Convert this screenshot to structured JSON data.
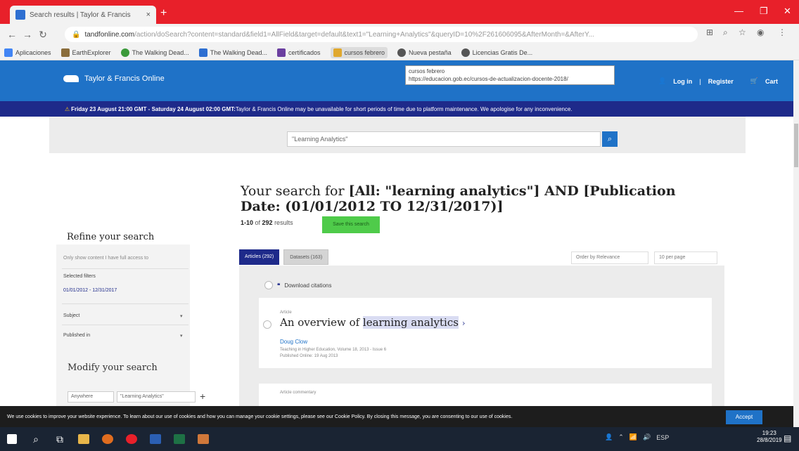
{
  "browser": {
    "tab_title": "Search results | Taylor & Francis",
    "tab_close": "×",
    "new_tab": "+",
    "url_domain": "tandfonline.com",
    "url_rest": "/action/doSearch?content=standard&field1=AllField&target=default&text1=\"Learning+Analytics\"&queryID=10%2F261606095&AfterMonth=&AfterY...",
    "window_controls": [
      "—",
      "❐",
      "✕"
    ]
  },
  "bookmarks": [
    {
      "label": "Aplicaciones",
      "color": "#4285f4"
    },
    {
      "label": "EarthExplorer",
      "color": "#8a6d3b"
    },
    {
      "label": "The Walking Dead...",
      "color": "#3b9a3b"
    },
    {
      "label": "The Walking Dead...",
      "color": "#2e6fd1"
    },
    {
      "label": "certificados",
      "color": "#6b3fa0"
    },
    {
      "label": "cursos febrero",
      "color": "#e0a82e"
    },
    {
      "label": "Nueva pestaña",
      "color": "#555555"
    },
    {
      "label": "Licencias Gratis De...",
      "color": "#555555"
    }
  ],
  "tooltip": {
    "line1": "cursos febrero",
    "line2": "https://educacion.gob.ec/cursos-de-actualizacion-docente-2018/"
  },
  "site": {
    "logo": "Taylor & Francis Online",
    "login": "Log in",
    "sep": "|",
    "register": "Register",
    "cart": "Cart"
  },
  "notice": {
    "bold": "Friday 23 August 21:00 GMT - Saturday 24 August 02:00 GMT:",
    "text": " Taylor & Francis Online may be unavailable for short periods of time due to platform maintenance. We apologise for any inconvenience."
  },
  "search": {
    "value": "\"Learning Analytics\"",
    "button": "⌕"
  },
  "results": {
    "heading_plain": "Your search for ",
    "heading_bold": "[All: \"learning analytics\"] AND [Publication Date: (01/01/2012 TO 12/31/2017)]",
    "count_range": "1-10",
    "count_of": " of ",
    "count_total": "292",
    "count_suffix": " results",
    "save_button": "Save this search",
    "tab_articles": "Articles (292)",
    "tab_datasets": "Datasets (163)",
    "order": "Order by Relevance",
    "per_page": "10 per page",
    "download": "Download citations"
  },
  "sidebar": {
    "refine_title": "Refine your search",
    "only_access": "Only show content I have full access to",
    "selected_filters": "Selected filters",
    "filter_date": "01/01/2012 - 12/31/2017",
    "subject": "Subject",
    "published_in": "Published in",
    "modify_title": "Modify your search",
    "field_select": "Anywhere",
    "field_value": "\"Learning Analytics\"",
    "plus": "+"
  },
  "cards": [
    {
      "type": "Article",
      "title_pre": "An overview of ",
      "title_hl": "learning analytics",
      "title_arrow": "›",
      "author": "Doug Clow",
      "journal": "Teaching in Higher Education, Volume 18, 2013 - Issue 6",
      "published": "Published Online: 19 Aug 2013"
    },
    {
      "type": "Article commentary"
    }
  ],
  "cookie": {
    "text": "We use cookies to improve your website experience. To learn about our use of cookies and how you can manage your cookie settings, please see our Cookie Policy. By closing this message, you are consenting to our use of cookies.",
    "accept": "Accept"
  },
  "taskbar": {
    "lang": "ESP",
    "time": "19:23",
    "date": "28/8/2019"
  }
}
